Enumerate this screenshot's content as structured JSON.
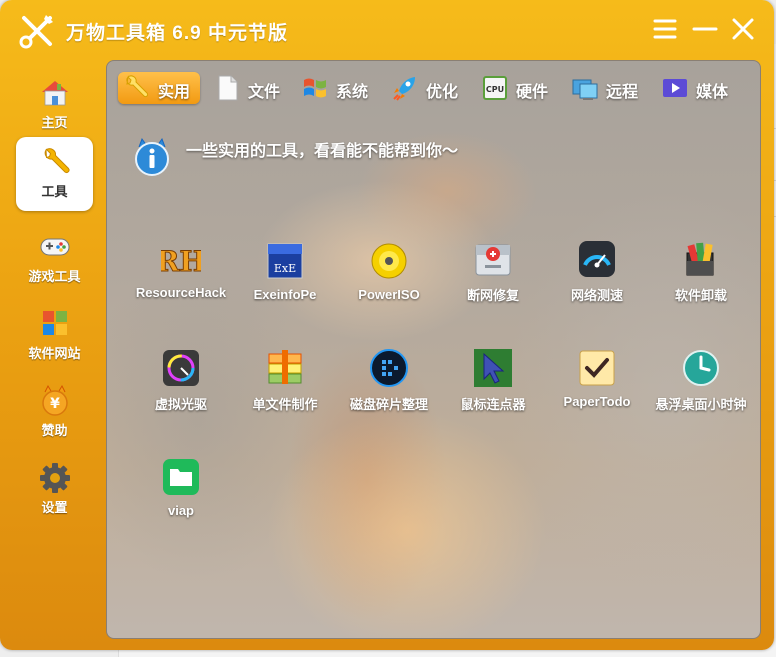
{
  "window": {
    "title": "万物工具箱 6.9 中元节版",
    "controls": [
      "menu-icon",
      "minimize-icon",
      "close-icon"
    ]
  },
  "sidebar": {
    "items": [
      {
        "label": "主页",
        "icon": "home-icon",
        "active": false
      },
      {
        "label": "工具",
        "icon": "wrench-icon",
        "active": true
      },
      {
        "label": "游戏工具",
        "icon": "gamepad-icon",
        "active": false
      },
      {
        "label": "软件网站",
        "icon": "windows-apps-icon",
        "active": false
      },
      {
        "label": "赞助",
        "icon": "yuan-coin-icon",
        "active": false
      },
      {
        "label": "设置",
        "icon": "gear-icon",
        "active": false
      }
    ]
  },
  "tabs": [
    {
      "label": "实用",
      "icon": "wrench-icon",
      "active": true
    },
    {
      "label": "文件",
      "icon": "file-icon",
      "active": false
    },
    {
      "label": "系统",
      "icon": "windows-logo-icon",
      "active": false
    },
    {
      "label": "优化",
      "icon": "rocket-icon",
      "active": false
    },
    {
      "label": "硬件",
      "icon": "cpu-icon",
      "active": false
    },
    {
      "label": "远程",
      "icon": "remote-desktop-icon",
      "active": false
    },
    {
      "label": "媒体",
      "icon": "play-icon",
      "active": false
    }
  ],
  "info": {
    "text": "一些实用的工具，看看能不能帮到你～",
    "icon": "info-icon"
  },
  "tools": [
    {
      "label": "ResourceHack",
      "icon": "resourcehack-icon"
    },
    {
      "label": "ExeinfoPe",
      "icon": "exeinfope-icon"
    },
    {
      "label": "PowerISO",
      "icon": "poweriso-disc-icon"
    },
    {
      "label": "断网修复",
      "icon": "network-repair-icon"
    },
    {
      "label": "网络测速",
      "icon": "speedometer-icon"
    },
    {
      "label": "软件卸载",
      "icon": "uninstall-icon"
    },
    {
      "label": "虚拟光驱",
      "icon": "virtual-drive-icon"
    },
    {
      "label": "单文件制作",
      "icon": "single-file-maker-icon"
    },
    {
      "label": "磁盘碎片整理",
      "icon": "defrag-icon"
    },
    {
      "label": "鼠标连点器",
      "icon": "mouse-clicker-icon"
    },
    {
      "label": "PaperTodo",
      "icon": "papertodo-check-icon"
    },
    {
      "label": "悬浮桌面小时钟",
      "icon": "clock-icon"
    },
    {
      "label": "viap",
      "icon": "folder-icon"
    }
  ]
}
